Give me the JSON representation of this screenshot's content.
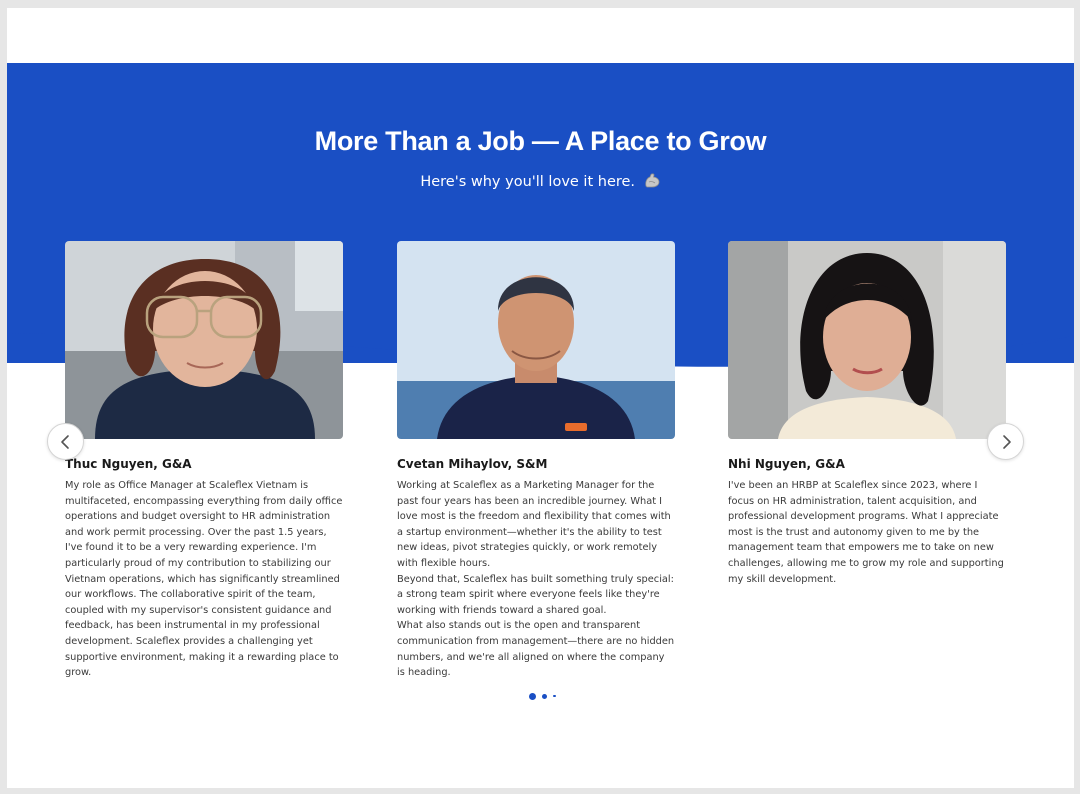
{
  "header": {
    "title": "More Than a Job — A Place to Grow",
    "subtitle": "Here's why you'll love it here.",
    "subtitle_emoji_icon": "flexed-biceps-icon"
  },
  "testimonials": [
    {
      "name": "Thuc Nguyen, G&A",
      "text": "My role as Office Manager at Scaleflex Vietnam is multifaceted, encompassing everything from daily office operations and budget oversight to HR administration and work permit processing. Over the past 1.5 years, I've found it to be a very rewarding experience. I'm particularly proud of my contribution to stabilizing our Vietnam operations, which has significantly streamlined our workflows. The collaborative spirit of the team, coupled with my supervisor's consistent guidance and feedback, has been instrumental in my professional development. Scaleflex provides a challenging yet supportive environment, making it a rewarding place to grow."
    },
    {
      "name": "Cvetan Mihaylov, S&M",
      "text": "Working at Scaleflex as a Marketing Manager for the past four years has been an incredible journey. What I love most is the freedom and flexibility that comes with a startup environment—whether it's the ability to test new ideas, pivot strategies quickly, or work remotely with flexible hours.\nBeyond that, Scaleflex has built something truly special: a strong team spirit where everyone feels like they're working with friends toward a shared goal.\nWhat also stands out is the open and transparent communication from management—there are no hidden numbers, and we're all aligned on where the company is heading."
    },
    {
      "name": "Nhi Nguyen, G&A",
      "text": "I've been an HRBP at Scaleflex since 2023, where I focus on HR administration, talent acquisition, and professional development programs. What I appreciate most is the trust and autonomy given to me by the management team that empowers me to take on new challenges, allowing me to grow my role and supporting my skill development."
    }
  ],
  "carousel": {
    "prev_icon": "chevron-left-icon",
    "next_icon": "chevron-right-icon",
    "page_count": 3,
    "active_index": 0
  },
  "colors": {
    "brand_blue": "#1a4fc4",
    "text": "#3a3a3a",
    "background": "#ffffff"
  }
}
